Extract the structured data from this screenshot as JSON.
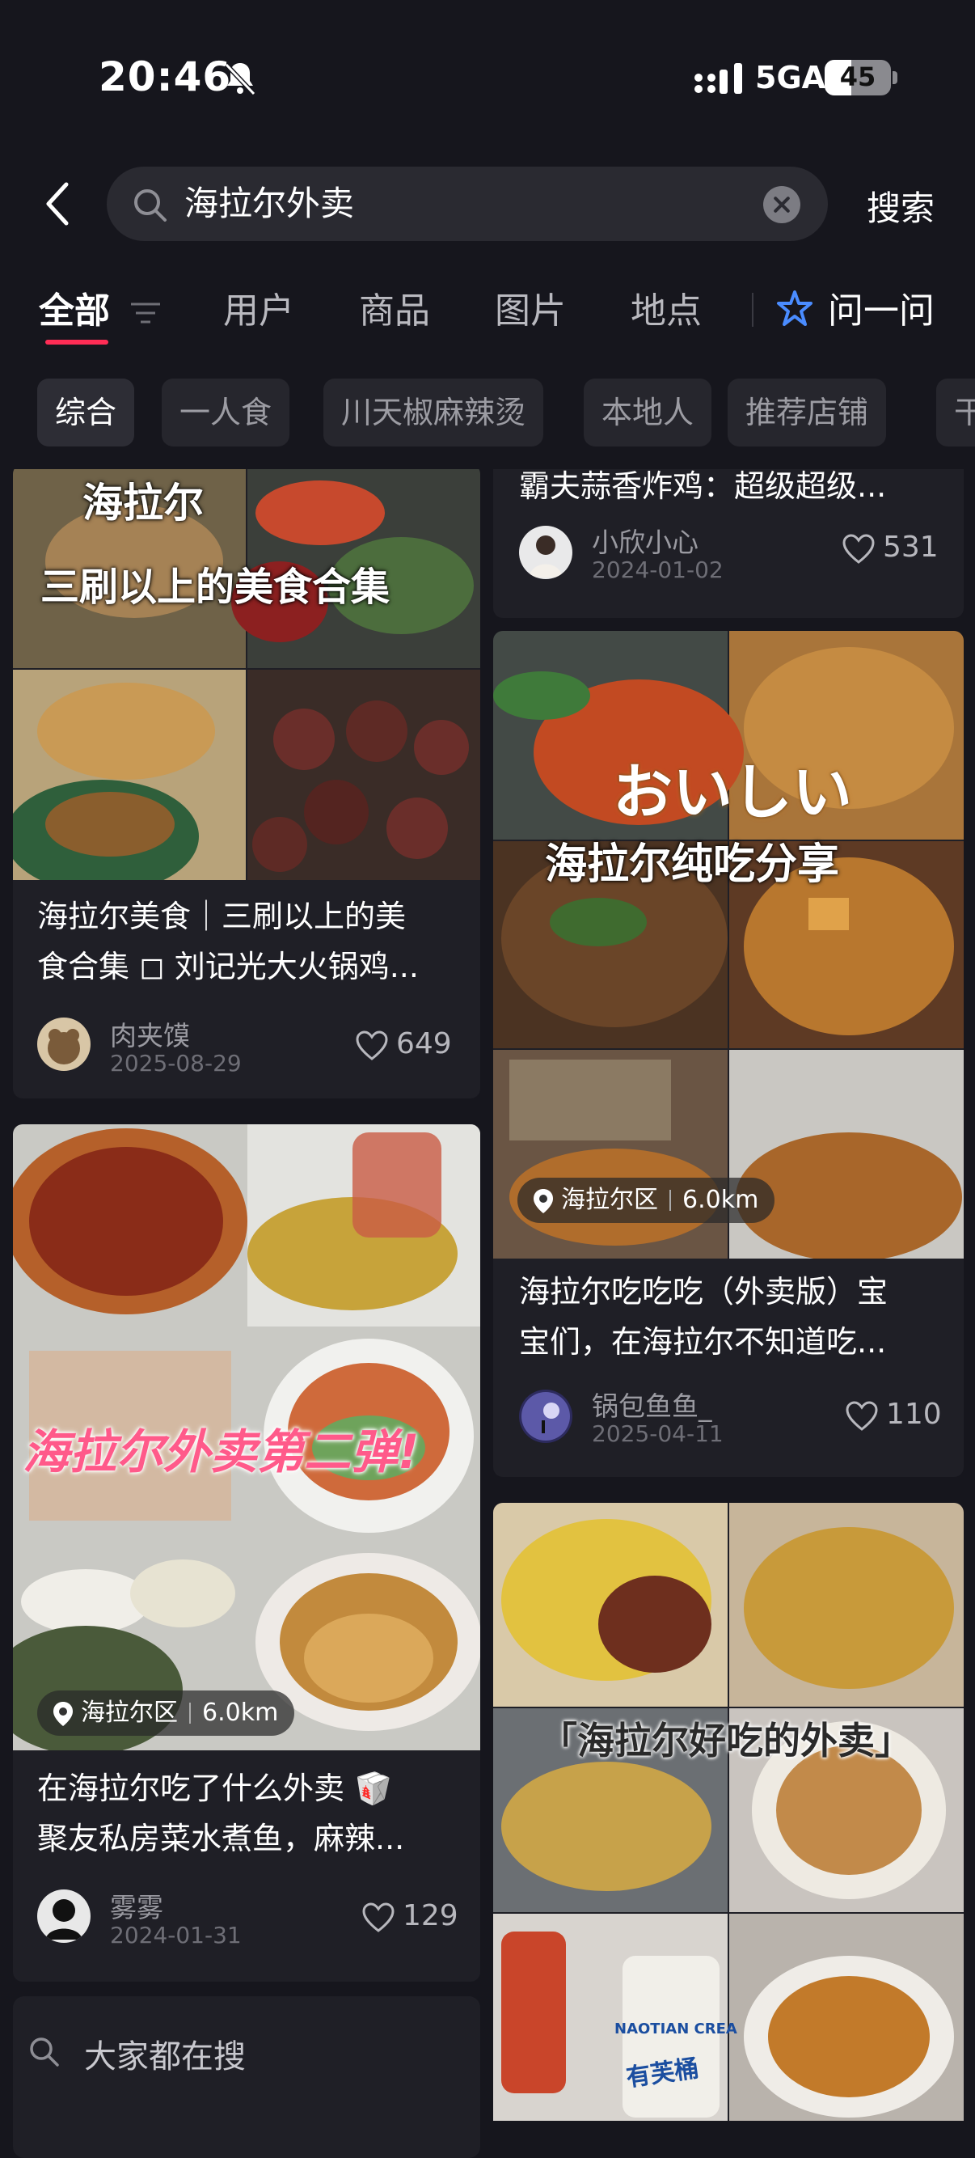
{
  "status_bar": {
    "time": "20:46",
    "network": "5GA",
    "battery": "45"
  },
  "search": {
    "query": "海拉尔外卖",
    "submit_label": "搜索"
  },
  "tabs": [
    {
      "label": "全部"
    },
    {
      "label": "用户"
    },
    {
      "label": "商品"
    },
    {
      "label": "图片"
    },
    {
      "label": "地点"
    },
    {
      "label": "问一问"
    }
  ],
  "chips": [
    {
      "label": "综合"
    },
    {
      "label": "一人食"
    },
    {
      "label": "川天椒麻辣烫"
    },
    {
      "label": "本地人"
    },
    {
      "label": "推荐店铺"
    },
    {
      "label": "干"
    }
  ],
  "posts": [
    {
      "overlay_lines": [
        "海拉尔",
        "三刷以上的美食合集"
      ],
      "title_lines": [
        "海拉尔美食｜三刷以上的美",
        "食合集 ◻ 刘记光大火锅鸡..."
      ],
      "author": "肉夹馍",
      "date": "2025-08-29",
      "likes": "649"
    },
    {
      "overlay_lines": [
        "海拉尔外卖第二弹!"
      ],
      "location": "海拉尔区",
      "distance": "6.0km",
      "title_lines": [
        "在海拉尔吃了什么外卖 🥡",
        "聚友私房菜水煮鱼，麻辣..."
      ],
      "author": "雾雾",
      "date": "2024-01-31",
      "likes": "129"
    },
    {
      "title_lines": [
        "霸夫蒜香炸鸡：超级超级..."
      ],
      "author": "小欣小心",
      "date": "2024-01-02",
      "likes": "531"
    },
    {
      "overlay_lines": [
        "おいしい",
        "海拉尔纯吃分享"
      ],
      "location": "海拉尔区",
      "distance": "6.0km",
      "title_lines": [
        "海拉尔吃吃吃（外卖版）宝",
        "宝们，在海拉尔不知道吃..."
      ],
      "author": "锅包鱼鱼_",
      "date": "2025-04-11",
      "likes": "110"
    },
    {
      "overlay_lines": [
        "「海拉尔好吃的外卖」"
      ],
      "package_texts": [
        "有芙桶",
        "NAOTIAN CREA"
      ]
    }
  ],
  "trending": {
    "label": "大家都在搜"
  }
}
